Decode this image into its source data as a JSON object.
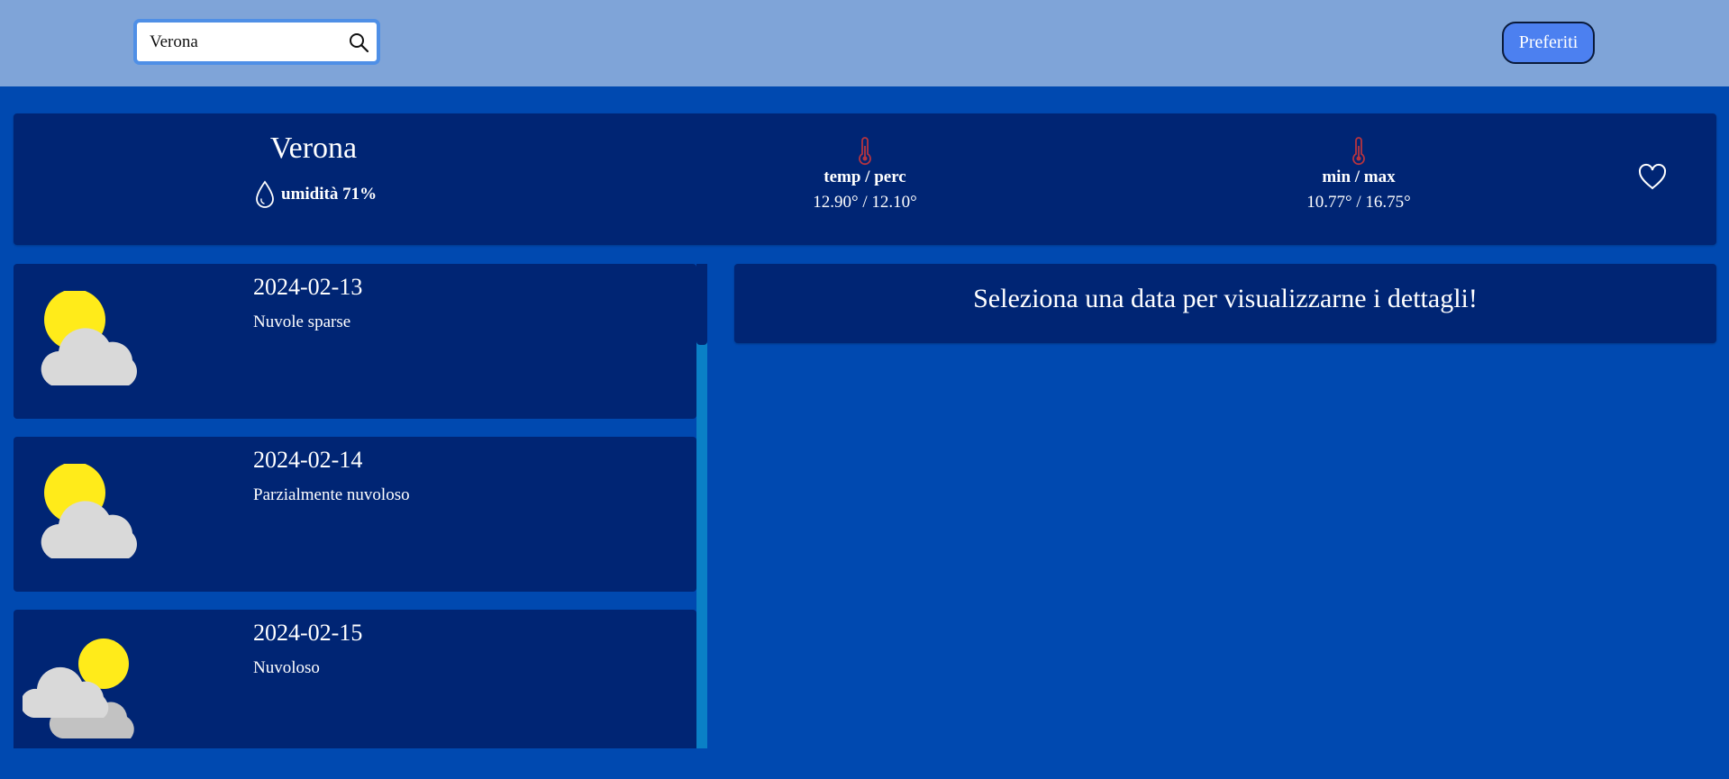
{
  "search": {
    "value": "Verona",
    "icon": "search-icon"
  },
  "header": {
    "favorites_label": "Preferiti"
  },
  "current": {
    "city": "Verona",
    "humidity_text": "umidità 71%",
    "temp_label": "temp / perc",
    "temp_value": "12.90° / 12.10°",
    "minmax_label": "min / max",
    "minmax_value": "10.77° / 16.75°",
    "favorite_icon": "heart-icon"
  },
  "forecast": [
    {
      "date": "2024-02-13",
      "description": "Nuvole sparse",
      "icon": "scattered-clouds-icon"
    },
    {
      "date": "2024-02-14",
      "description": "Parzialmente nuvoloso",
      "icon": "partly-cloudy-icon"
    },
    {
      "date": "2024-02-15",
      "description": "Nuvoloso",
      "icon": "cloudy-icon"
    }
  ],
  "detail": {
    "message": "Seleziona una data per visualizzarne i dettagli!"
  },
  "colors": {
    "page_bg": "#0049b0",
    "topbar_bg": "#7fa4d8",
    "card_bg": "#002574",
    "button_bg": "#4c80f0",
    "thermometer": "#b7343f",
    "sun": "#ffeb1a",
    "cloud": "#d9d9d9"
  }
}
